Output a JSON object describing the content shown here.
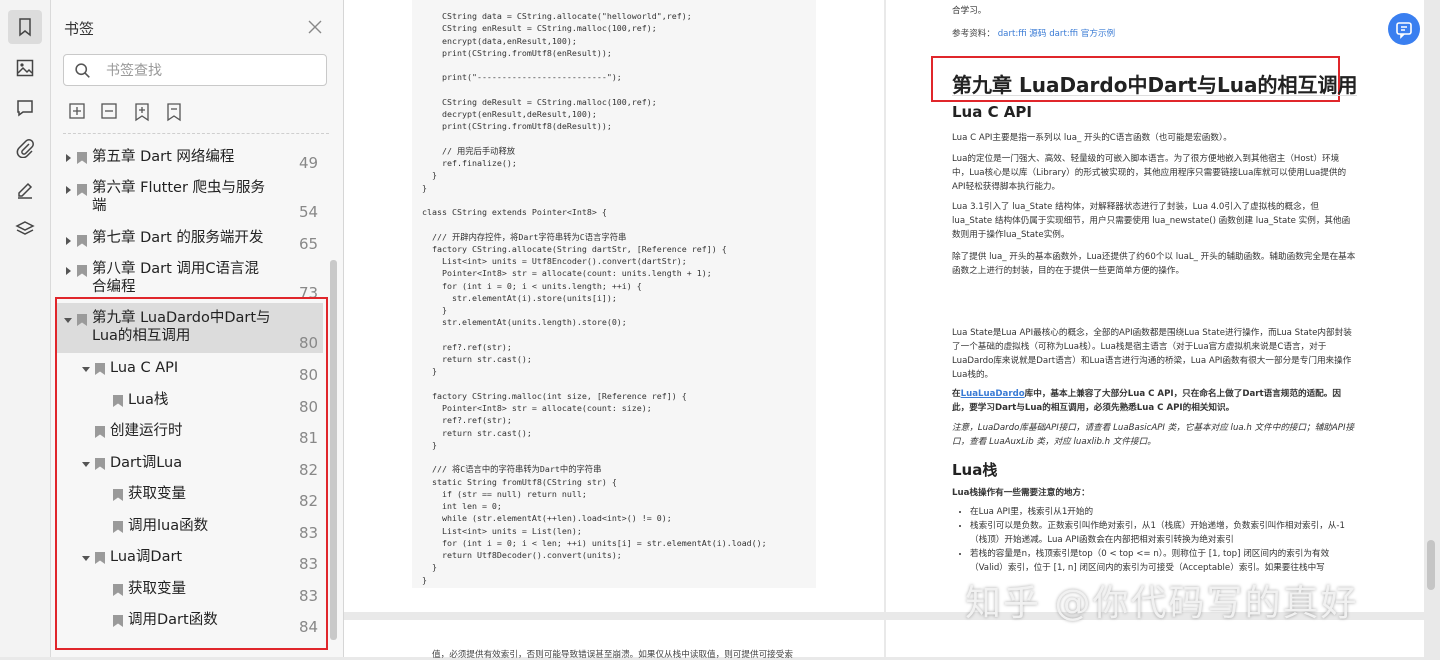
{
  "sidebar": {
    "title": "书签",
    "search_placeholder": "书签查找",
    "items": [
      {
        "label": "第五章 Dart 网络编程",
        "page": "49"
      },
      {
        "label": "第六章 Flutter 爬虫与服务端",
        "page": "54"
      },
      {
        "label": "第七章 Dart 的服务端开发",
        "page": "65"
      },
      {
        "label": "第八章 Dart 调用C语言混合编程",
        "page": "73"
      },
      {
        "label": "第九章 LuaDardo中Dart与Lua的相互调用",
        "page": "80"
      },
      {
        "label": "Lua C API",
        "page": "80"
      },
      {
        "label": "Lua栈",
        "page": "80"
      },
      {
        "label": "创建运行时",
        "page": "81"
      },
      {
        "label": "Dart调Lua",
        "page": "82"
      },
      {
        "label": "获取变量",
        "page": "82"
      },
      {
        "label": "调用lua函数",
        "page": "83"
      },
      {
        "label": "Lua调Dart",
        "page": "83"
      },
      {
        "label": "获取变量",
        "page": "83"
      },
      {
        "label": "调用Dart函数",
        "page": "84"
      }
    ]
  },
  "document": {
    "code_text": "    CString data = CString.allocate(\"helloworld\",ref);\n    CString enResult = CString.malloc(100,ref);\n    encrypt(data,enResult,100);\n    print(CString.fromUtf8(enResult));\n\n    print(\"--------------------------\");\n\n    CString deResult = CString.malloc(100,ref);\n    decrypt(enResult,deResult,100);\n    print(CString.fromUtf8(deResult));\n\n    // 用完后手动释放\n    ref.finalize();\n  }\n}\n\nclass CString extends Pointer<Int8> {\n\n  /// 开辟内存控件，将Dart字符串转为C语言字符串\n  factory CString.allocate(String dartStr, [Reference ref]) {\n    List<int> units = Utf8Encoder().convert(dartStr);\n    Pointer<Int8> str = allocate(count: units.length + 1);\n    for (int i = 0; i < units.length; ++i) {\n      str.elementAt(i).store(units[i]);\n    }\n    str.elementAt(units.length).store(0);\n\n    ref?.ref(str);\n    return str.cast();\n  }\n\n  factory CString.malloc(int size, [Reference ref]) {\n    Pointer<Int8> str = allocate(count: size);\n    ref?.ref(str);\n    return str.cast();\n  }\n\n  /// 将C语言中的字符串转为Dart中的字符串\n  static String fromUtf8(CString str) {\n    if (str == null) return null;\n    int len = 0;\n    while (str.elementAt(++len).load<int>() != 0);\n    List<int> units = List(len);\n    for (int i = 0; i < len; ++i) units[i] = str.elementAt(i).load();\n    return Utf8Decoder().convert(units);\n  }\n}",
    "top_fragment": "合学习。",
    "ref_label": "参考资料：",
    "ref_link1": "dart:ffi 源码",
    "ref_link2": "dart:ffi 官方示例",
    "chapter_title": "第九章 LuaDardo中Dart与Lua的相互调用",
    "section1_title": "Lua C API",
    "para1": "Lua C API主要是指一系列以 lua_ 开头的C语言函数（也可能是宏函数）。",
    "para2": "Lua的定位是一门强大、高效、轻量级的可嵌入脚本语言。为了很方便地嵌入到其他宿主（Host）环境中，Lua核心是以库（Library）的形式被实现的，其他应用程序只需要链接Lua库就可以使用Lua提供的API轻松获得脚本执行能力。",
    "para3": "Lua 3.1引入了 lua_State 结构体，对解释器状态进行了封装，Lua 4.0引入了虚拟栈的概念，但 lua_State 结构体仍属于实现细节，用户只需要使用 lua_newstate() 函数创建 lua_State 实例，其他函数则用于操作lua_State实例。",
    "para4": "除了提供 lua_ 开头的基本函数外，Lua还提供了约60个以 luaL_ 开头的辅助函数。辅助函数完全是在基本函数之上进行的封装，目的在于提供一些更简单方便的操作。",
    "para5": "Lua State是Lua API最核心的概念，全部的API函数都是围绕Lua State进行操作，而Lua State内部封装了一个基础的虚拟栈（可称为Lua栈）。Lua栈是宿主语言（对于Lua官方虚拟机来说是C语言，对于LuaDardo库来说就是Dart语言）和Lua语言进行沟通的桥梁，Lua API函数有很大一部分是专门用来操作Lua栈的。",
    "para6_link": "LuaLuaDardo",
    "para6_prefix": "在",
    "para6": "库中，基本上兼容了大部分Lua C API，只在命名上做了Dart语言规范的适配。因此，要学习Dart与Lua的相互调用，必须先熟悉Lua C API的相关知识。",
    "para7": "注意，LuaDardo库基础API接口，请查看 LuaBasicAPI 类，它基本对应 lua.h 文件中的接口；辅助API接口，查看 LuaAuxLib 类，对应 luaxlib.h 文件接口。",
    "section2_title": "Lua栈",
    "para8": "Lua栈操作有一些需要注意的地方：",
    "bullet1": "在Lua API里，栈索引从1开始的",
    "bullet2": "栈索引可以是负数。正数索引叫作绝对索引，从1（栈底）开始递增，负数索引叫作相对索引，从-1（栈顶）开始递减。Lua API函数会在内部把相对索引转换为绝对索引",
    "bullet3": "若栈的容量是n，栈顶索引是top（0 < top <= n）。则称位于 [1, top] 闭区间内的索引为有效（Valid）索引，位于 [1, n] 闭区间内的索引为可接受（Acceptable）索引。如果要往栈中写",
    "bottom_line": "值，必须提供有效索引，否则可能导致错误甚至崩溃。如果仅从栈中读取值，则可提供可接受索",
    "watermark": "知乎 @你代码写的真好"
  },
  "colors": {
    "highlight_red": "#e0262b",
    "link_blue": "#3a7bd5",
    "selected_bg": "#dcdcdc",
    "fab_blue": "#3a7ff0"
  }
}
